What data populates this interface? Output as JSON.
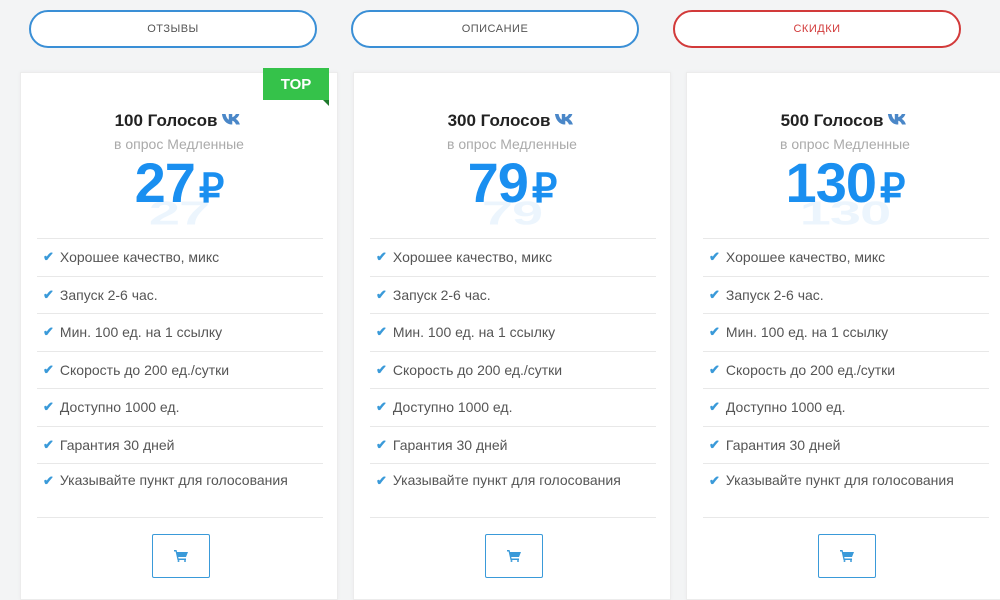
{
  "tabs": [
    {
      "label": "ОТЗЫВЫ"
    },
    {
      "label": "ОПИСАНИЕ"
    },
    {
      "label": "СКИДКИ"
    }
  ],
  "cards": [
    {
      "title": "100 Голосов",
      "subtitle": "в опрос Медленные",
      "price": "27",
      "currency": "₽",
      "badge": "TOP",
      "features": [
        "Хорошее качество, микс",
        "Запуск 2-6 час.",
        "Мин. 100 ед. на 1 ссылку",
        "Скорость до 200 ед./сутки",
        "Доступно 1000 ед.",
        "Гарантия 30 дней",
        "Указывайте пункт для голосования"
      ]
    },
    {
      "title": "300 Голосов",
      "subtitle": "в опрос Медленные",
      "price": "79",
      "currency": "₽",
      "features": [
        "Хорошее качество, микс",
        "Запуск 2-6 час.",
        "Мин. 100 ед. на 1 ссылку",
        "Скорость до 200 ед./сутки",
        "Доступно 1000 ед.",
        "Гарантия 30 дней",
        "Указывайте пункт для голосования"
      ]
    },
    {
      "title": "500 Голосов",
      "subtitle": "в опрос Медленные",
      "price": "130",
      "currency": "₽",
      "features": [
        "Хорошее качество, микс",
        "Запуск 2-6 час.",
        "Мин. 100 ед. на 1 ссылку",
        "Скорость до 200 ед./сутки",
        "Доступно 1000 ед.",
        "Гарантия 30 дней",
        "Указывайте пункт для голосования"
      ]
    }
  ],
  "nav": {
    "prev": "‹",
    "next": "›"
  },
  "colors": {
    "accent": "#1a8ff0",
    "badge": "#35c24a",
    "tab_red": "#d23a3a",
    "tab_blue": "#3a8fd6"
  }
}
